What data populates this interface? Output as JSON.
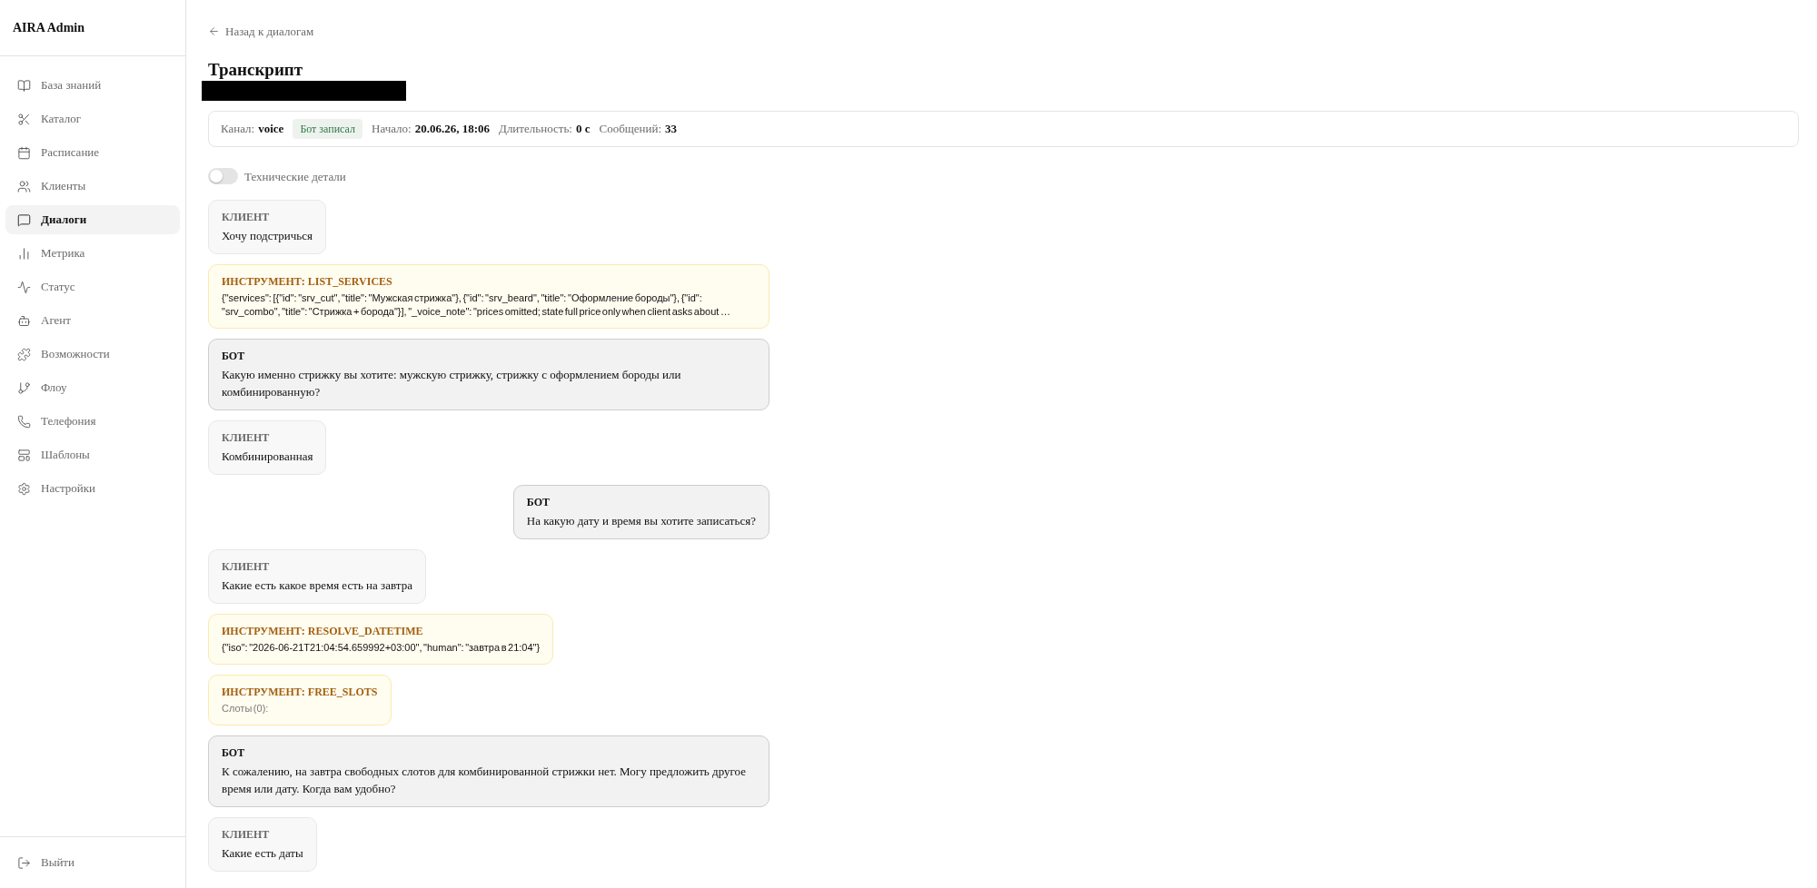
{
  "sidebar": {
    "brand": "AIRA Admin",
    "items": [
      {
        "label": "База знаний",
        "selected": false
      },
      {
        "label": "Каталог",
        "selected": false
      },
      {
        "label": "Расписание",
        "selected": false
      },
      {
        "label": "Клиенты",
        "selected": false
      },
      {
        "label": "Диалоги",
        "selected": true
      },
      {
        "label": "Метрика",
        "selected": false
      },
      {
        "label": "Статус",
        "selected": false
      },
      {
        "label": "Агент",
        "selected": false
      },
      {
        "label": "Возможности",
        "selected": false
      },
      {
        "label": "Флоу",
        "selected": false
      },
      {
        "label": "Телефония",
        "selected": false
      },
      {
        "label": "Шаблоны",
        "selected": false
      },
      {
        "label": "Настройки",
        "selected": false
      }
    ],
    "logout": "Выйти"
  },
  "back_link": "Назад к диалогам",
  "title": "Транскрипт",
  "info": [
    {
      "kind": "field",
      "label": "Канал:",
      "value": "voice"
    },
    {
      "kind": "badge",
      "text": "Бот записал"
    },
    {
      "kind": "field",
      "label": "Начало:",
      "value": "20.06.26, 18:06"
    },
    {
      "kind": "field",
      "label": "Длительность:",
      "value": "0 с"
    },
    {
      "kind": "field",
      "label": "Сообщений:",
      "value": "33"
    }
  ],
  "tech_toggle": {
    "label": "Технические детали",
    "on": false
  },
  "messages": [
    {
      "kind": "client",
      "label": "КЛИЕНТ",
      "text": "Хочу подстричься"
    },
    {
      "kind": "tool",
      "label": "ИНСТРУМЕНТ: LIST_SERVICES",
      "text": "{\"services\": [{\"id\": \"srv_cut\", \"title\": \"Мужская стрижка\"}, {\"id\": \"srv_beard\", \"title\": \"Оформление бороды\"}, {\"id\": \"srv_combo\", \"title\": \"Стрижка + борода\"}], \"_voice_note\": \"prices omitted; state full price only when client asks about …",
      "muted": false
    },
    {
      "kind": "bot",
      "label": "БОТ",
      "text": "Какую именно стрижку вы хотите: мужскую стрижку, стрижку с оформлением бороды или комбинированную?"
    },
    {
      "kind": "client",
      "label": "КЛИЕНТ",
      "text": "Комбинированная"
    },
    {
      "kind": "bot",
      "label": "БОТ",
      "text": "На какую дату и время вы хотите записаться?"
    },
    {
      "kind": "client",
      "label": "КЛИЕНТ",
      "text": "Какие есть какое время есть на завтра"
    },
    {
      "kind": "tool",
      "label": "ИНСТРУМЕНТ: RESOLVE_DATETIME",
      "text": "{\"iso\": \"2026-06-21T21:04:54.659992+03:00\", \"human\": \"завтра в 21:04\"}",
      "muted": false
    },
    {
      "kind": "tool",
      "label": "ИНСТРУМЕНТ: FREE_SLOTS",
      "text": "Слоты (0):",
      "muted": true
    },
    {
      "kind": "bot",
      "label": "БОТ",
      "text": "К сожалению, на завтра свободных слотов для комбинированной стрижки нет. Могу предложить другое время или дату. Когда вам удобно?"
    },
    {
      "kind": "client",
      "label": "КЛИЕНТ",
      "text": "Какие есть даты"
    }
  ]
}
